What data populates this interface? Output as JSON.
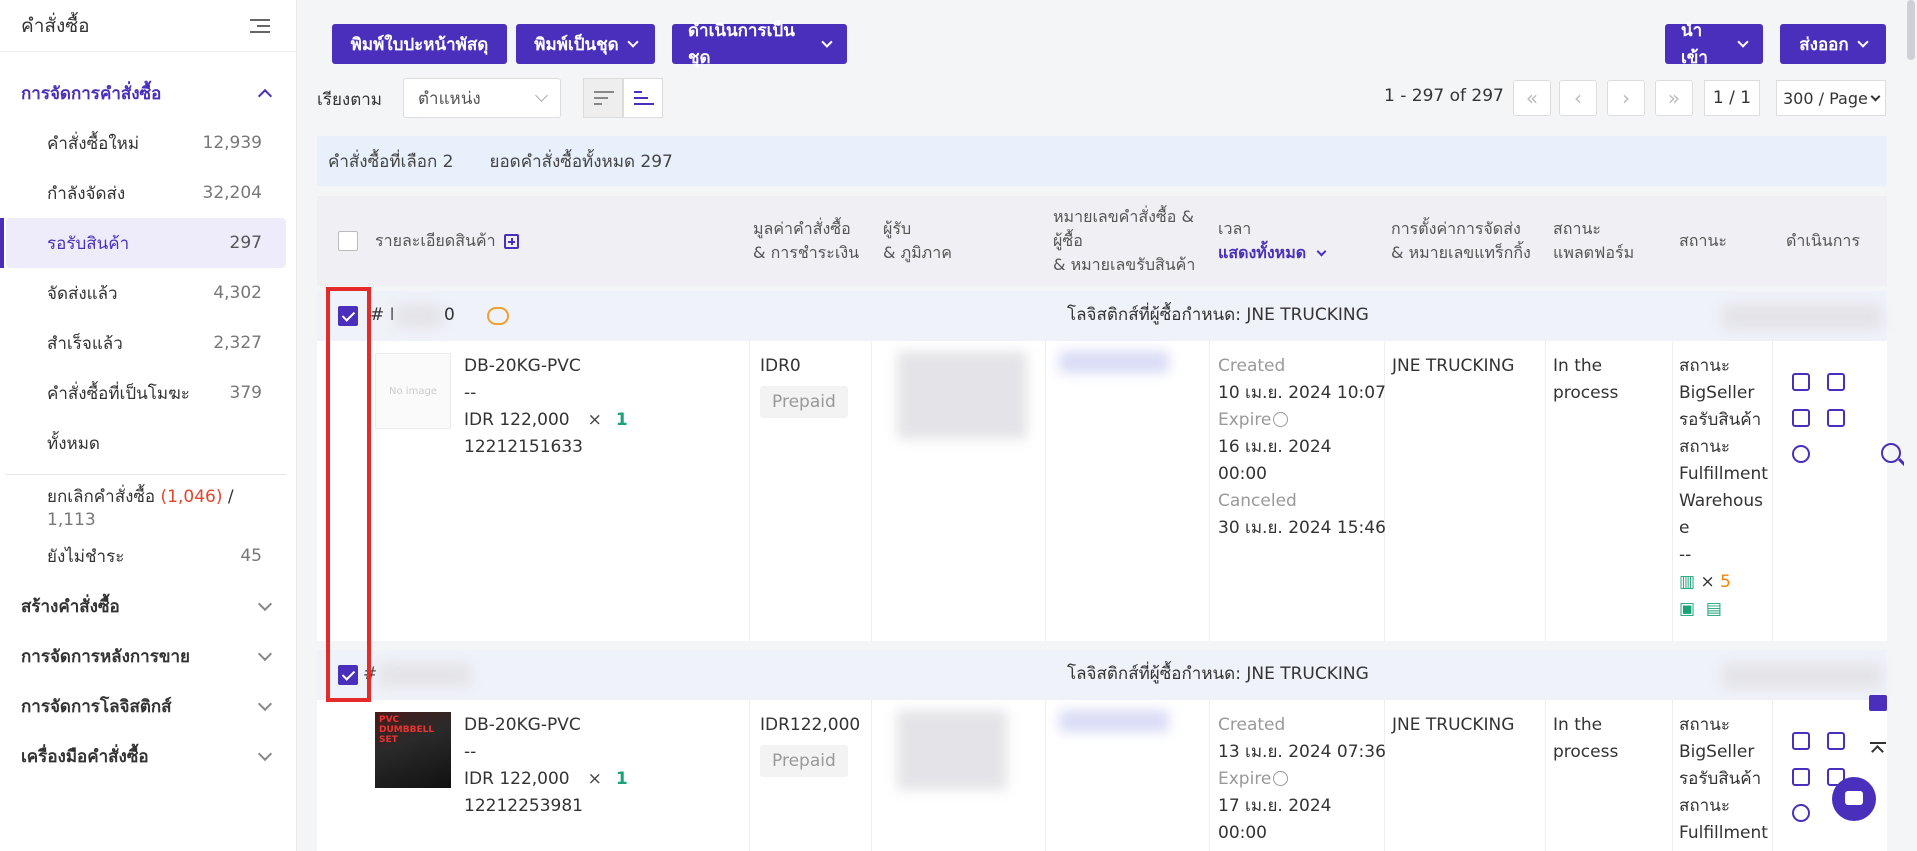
{
  "sidebar": {
    "title": "คำสั่งซื้อ",
    "active_section": "การจัดการคำสั่งซื้อ",
    "items": [
      {
        "label": "คำสั่งซื้อใหม่",
        "count": "12,939"
      },
      {
        "label": "กำลังจัดส่ง",
        "count": "32,204"
      },
      {
        "label": "รอรับสินค้า",
        "count": "297"
      },
      {
        "label": "จัดส่งแล้ว",
        "count": "4,302"
      },
      {
        "label": "สำเร็จแล้ว",
        "count": "2,327"
      },
      {
        "label": "คำสั่งซื้อที่เป็นโมฆะ",
        "count": "379"
      },
      {
        "label": "ทั้งหมด",
        "count": ""
      }
    ],
    "cancel": {
      "label": "ยกเลิกคำสั่งซื้อ",
      "count_red": "(1,046)",
      "sep": "/",
      "total": "1,113"
    },
    "unpaid": {
      "label": "ยังไม่ชำระ",
      "count": "45"
    },
    "sections": [
      "สร้างคำสั่งซื้อ",
      "การจัดการหลังการขาย",
      "การจัดการโลจิสติกส์",
      "เครื่องมือคำสั่งซื้อ"
    ]
  },
  "toolbar": {
    "print_label": "พิมพ์ใบปะหน้าพัสดุ",
    "print_batch": "พิมพ์เป็นชุด",
    "batch_action": "ดำเนินการเป็นชุด",
    "import": "นำเข้า",
    "export": "ส่งออก"
  },
  "sort": {
    "label": "เรียงตาม",
    "value": "ตำแหน่ง"
  },
  "pager": {
    "range": "1 - 297 of 297",
    "page": "1 / 1",
    "per_page": "300 / Page"
  },
  "info": {
    "selected": "คำสั่งซื้อที่เลือก 2",
    "total": "ยอดคำสั่งซื้อทั้งหมด 297"
  },
  "columns": {
    "product": "รายละเอียดสินค้า",
    "value1": "มูลค่าคำสั่งซื้อ",
    "value2": "& การชำระเงิน",
    "recv1": "ผู้รับ",
    "recv2": "& ภูมิภาค",
    "ord1": "หมายเลขคำสั่งซื้อ &",
    "ord2": "ผู้ซื้อ",
    "ord3": "& หมายเลขรับสินค้า",
    "time1": "เวลา",
    "time2": "แสดงทั้งหมด",
    "ship1": "การตั้งค่าการจัดส่ง",
    "ship2": "& หมายเลขแทร็กกิ้ง",
    "plat1": "สถานะ",
    "plat2": "แพลตฟอร์ม",
    "status": "สถานะ",
    "action": "ดำเนินการ"
  },
  "orders": [
    {
      "id_prefix": "# I",
      "id_suffix": "0",
      "logistics": "โลจิสติกส์ที่ผู้ซื้อกำหนด: JNE TRUCKING",
      "sku": "DB-20KG-PVC",
      "dash": "--",
      "price": "IDR 122,000",
      "qty": "1",
      "code": "12212151633",
      "amount": "IDR0",
      "payment": "Prepaid",
      "created_label": "Created",
      "created": "10 เม.ย. 2024 10:07",
      "expire_label": "Expire",
      "expire": "16 เม.ย. 2024 00:00",
      "canceled_label": "Canceled",
      "canceled": "30 เม.ย. 2024 15:46",
      "shipping": "JNE TRUCKING",
      "platform_status": "In the process",
      "status_lines": [
        "สถานะ",
        "BigSeller",
        "รอรับสินค้า",
        "สถานะ",
        "Fulfillment",
        "Warehous",
        "e",
        "--"
      ],
      "barcode_count": "5",
      "noimg": "No image"
    },
    {
      "id_prefix": "#",
      "logistics": "โลจิสติกส์ที่ผู้ซื้อกำหนด: JNE TRUCKING",
      "sku": "DB-20KG-PVC",
      "dash": "--",
      "price": "IDR 122,000",
      "qty": "1",
      "code": "12212253981",
      "amount": "IDR122,000",
      "payment": "Prepaid",
      "created_label": "Created",
      "created": "13 เม.ย. 2024 07:36",
      "expire_label": "Expire",
      "expire": "17 เม.ย. 2024 00:00",
      "shipping": "JNE TRUCKING",
      "platform_status": "In the process",
      "status_lines": [
        "สถานะ",
        "BigSeller",
        "รอรับสินค้า",
        "สถานะ",
        "Fulfillment"
      ],
      "img_text": "PVC DUMBBELL SET"
    }
  ],
  "colors": {
    "primary": "#4a2fbd",
    "highlight": "#e52a2a",
    "accent_green": "#1aa37a",
    "accent_orange": "#f0840a"
  }
}
